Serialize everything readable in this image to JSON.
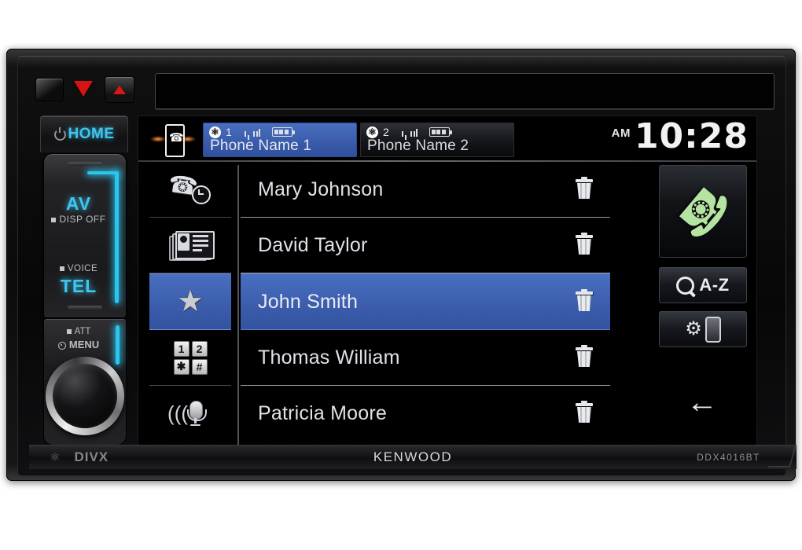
{
  "device": {
    "brand": "KENWOOD",
    "model": "DDX4016BT",
    "divx_label": "DIVX",
    "bluetooth_glyph": "ʙ",
    "bt_symbol": "ᛦ"
  },
  "hardware": {
    "reset_button": "reset",
    "tilt_button": "tilt-down",
    "eject_button": "eject",
    "disc_slot": "disc-slot",
    "home_label": "HOME",
    "av_label": "AV",
    "disp_off_label": "DISP OFF",
    "voice_label": "VOICE",
    "tel_label": "TEL",
    "att_label": "ATT",
    "menu_label": "MENU",
    "volume_knob": "volume-knob"
  },
  "header": {
    "phone_icon": "phone-connected-icon",
    "clock": {
      "ampm": "AM",
      "time": "10:28"
    },
    "tabs": [
      {
        "index": "1",
        "name": "Phone Name 1",
        "bt_icon": "bluetooth-icon",
        "signal_icon": "signal-bars-icon",
        "battery_icon": "battery-full-icon",
        "active": true
      },
      {
        "index": "2",
        "name": "Phone Name 2",
        "bt_icon": "bluetooth-icon",
        "signal_icon": "signal-bars-icon",
        "battery_icon": "battery-full-icon",
        "active": false
      }
    ]
  },
  "rail": [
    {
      "name": "call-history",
      "icon": "handset-clock-icon",
      "selected": false
    },
    {
      "name": "phonebook",
      "icon": "contact-card-icon",
      "selected": false
    },
    {
      "name": "favorites",
      "icon": "star-icon",
      "selected": true
    },
    {
      "name": "keypad",
      "icon": "dialpad-icon",
      "keys": [
        "1",
        "2",
        "✱",
        "#"
      ],
      "selected": false
    },
    {
      "name": "voice-dial",
      "icon": "microphone-icon",
      "selected": false
    }
  ],
  "contacts": [
    {
      "name": "Mary Johnson",
      "selected": false,
      "delete_icon": "trash-icon"
    },
    {
      "name": "David Taylor",
      "selected": false,
      "delete_icon": "trash-icon"
    },
    {
      "name": "John Smith",
      "selected": true,
      "delete_icon": "trash-icon"
    },
    {
      "name": "Thomas William",
      "selected": false,
      "delete_icon": "trash-icon"
    },
    {
      "name": "Patricia Moore",
      "selected": false,
      "delete_icon": "trash-icon"
    }
  ],
  "right_panel": {
    "call_button": {
      "name": "call-button",
      "icon": "green-handset-icon"
    },
    "search_button": {
      "name": "search-az-button",
      "icon": "magnifier-icon",
      "label": "A-Z"
    },
    "settings_button": {
      "name": "phone-settings-button",
      "icon": "gear-phone-icon"
    },
    "back_button": {
      "name": "back-button",
      "icon": "back-arrow-icon",
      "glyph": "←"
    }
  },
  "colors": {
    "accent_blue": "#3a5cab",
    "neon_cyan": "#3ec6ef",
    "call_green": "#b5e3a2",
    "eject_red": "#d81313",
    "screen_black": "#000000"
  }
}
